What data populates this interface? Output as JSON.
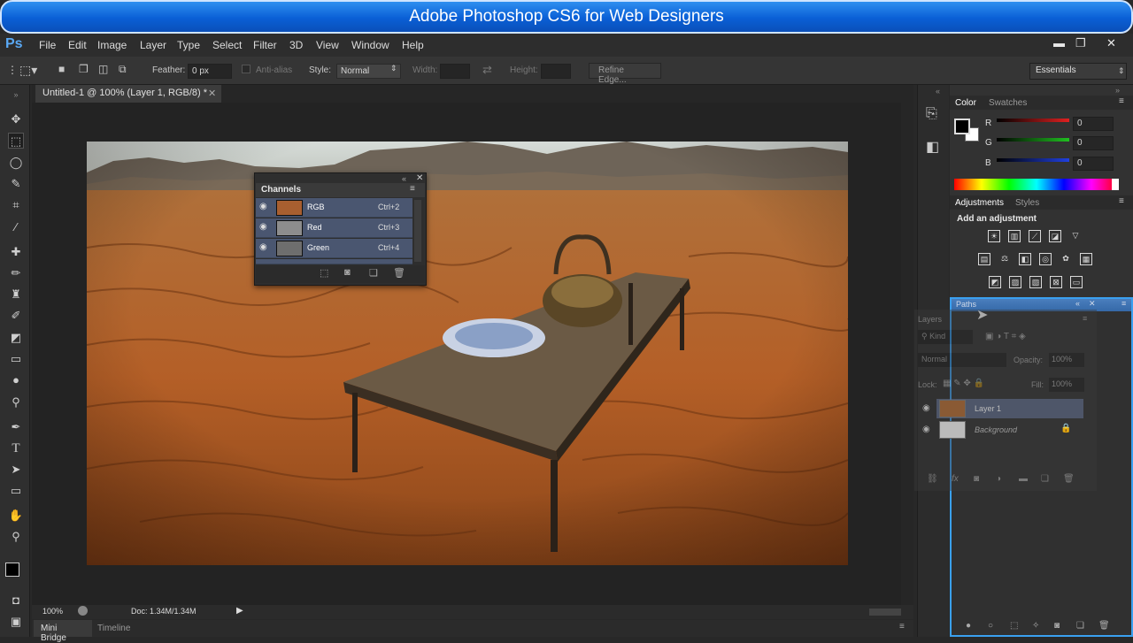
{
  "banner": {
    "title": "Adobe Photoshop CS6 for Web Designers"
  },
  "app": {
    "logo": "Ps"
  },
  "menu": [
    "File",
    "Edit",
    "Image",
    "Layer",
    "Type",
    "Select",
    "Filter",
    "3D",
    "View",
    "Window",
    "Help"
  ],
  "window_controls": {
    "minimize": "▬",
    "restore": "❐",
    "close": "✕"
  },
  "options": {
    "feather_label": "Feather:",
    "feather_value": "0 px",
    "antialias_label": "Anti-alias",
    "style_label": "Style:",
    "style_value": "Normal",
    "width_label": "Width:",
    "height_label": "Height:",
    "refine_edge": "Refine Edge...",
    "workspace": "Essentials"
  },
  "document": {
    "tab_title": "Untitled-1 @ 100% (Layer 1, RGB/8) *",
    "zoom": "100%",
    "doc_info": "Doc: 1.34M/1.34M"
  },
  "bottom_tabs": [
    "Mini Bridge",
    "Timeline"
  ],
  "channels": {
    "title": "Channels",
    "rows": [
      {
        "name": "RGB",
        "shortcut": "Ctrl+2"
      },
      {
        "name": "Red",
        "shortcut": "Ctrl+3"
      },
      {
        "name": "Green",
        "shortcut": "Ctrl+4"
      }
    ]
  },
  "color_panel": {
    "tabs": [
      "Color",
      "Swatches"
    ],
    "channels": [
      {
        "label": "R",
        "value": "0",
        "color": "#e02020"
      },
      {
        "label": "G",
        "value": "0",
        "color": "#20c020"
      },
      {
        "label": "B",
        "value": "0",
        "color": "#2040e0"
      }
    ]
  },
  "adjustments": {
    "tabs": [
      "Adjustments",
      "Styles"
    ],
    "heading": "Add an adjustment"
  },
  "paths": {
    "title": "Paths"
  },
  "layers": {
    "title": "Layers",
    "kind": "Kind",
    "blend_mode": "Normal",
    "opacity_label": "Opacity:",
    "opacity_value": "100%",
    "lock_label": "Lock:",
    "fill_label": "Fill:",
    "fill_value": "100%",
    "rows": [
      {
        "name": "Layer 1"
      },
      {
        "name": "Background"
      }
    ]
  },
  "colors": {
    "accent": "#3aa0f0",
    "banner": "#0a5fd6"
  }
}
